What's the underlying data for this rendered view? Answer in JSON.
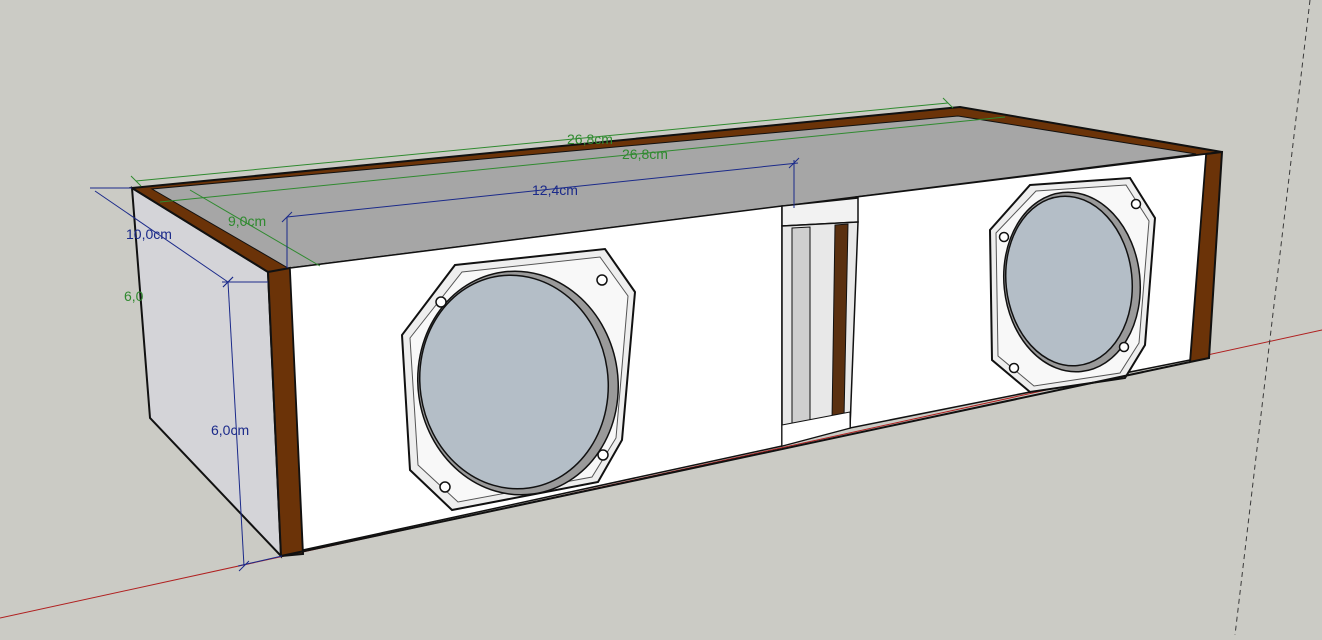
{
  "model": {
    "name": "center speaker enclosure",
    "colors": {
      "background": "#cbcbc5",
      "top_face": "#a6a6a6",
      "front_face": "#ffffff",
      "side_face": "#d4d4d8",
      "wood_edge": "#6b3308",
      "cone": "#b4bec7",
      "dimension_blue": "#1b2a8a",
      "dimension_green": "#2f8a2f",
      "axis_red": "#b02020"
    },
    "drivers": [
      "left-driver",
      "right-driver"
    ],
    "port": "slot-port"
  },
  "dimensions": {
    "overall_length_outer": "26,8cm",
    "overall_length_inner": "26,8cm",
    "front_width": "12,4cm",
    "top_depth": "9,0cm",
    "side_depth": "10,0cm",
    "height_front": "6,0cm",
    "height_back": "6,0"
  }
}
